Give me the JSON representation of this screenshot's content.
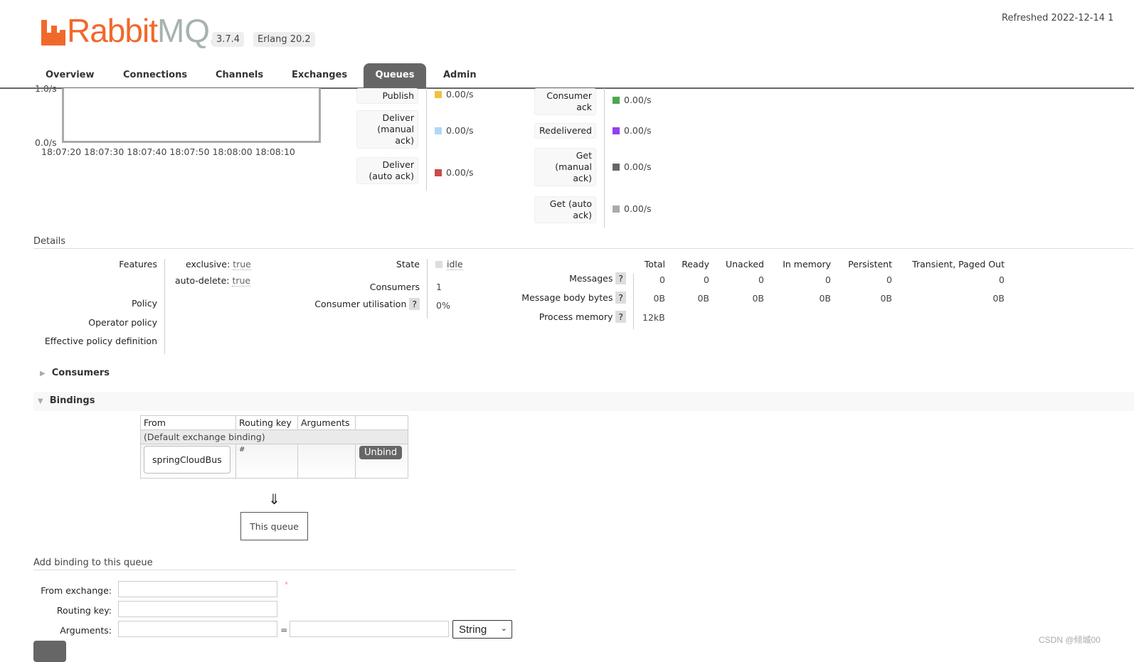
{
  "header": {
    "logo_text": "RabbitMQ",
    "version": "3.7.4",
    "erlang": "Erlang 20.2",
    "refreshed": "Refreshed 2022-12-14 1"
  },
  "nav": {
    "tabs": [
      "Overview",
      "Connections",
      "Channels",
      "Exchanges",
      "Queues",
      "Admin"
    ],
    "active": "Queues"
  },
  "chart": {
    "y_top": "1.0/s",
    "y_bottom": "0.0/s",
    "x_ticks": [
      "18:07:20",
      "18:07:30",
      "18:07:40",
      "18:07:50",
      "18:08:00",
      "18:08:10"
    ]
  },
  "rates_left": [
    {
      "label": "Publish",
      "value": "0.00/s",
      "color": "#edc240"
    },
    {
      "label": "Deliver (manual ack)",
      "value": "0.00/s",
      "color": "#afd8f8"
    },
    {
      "label": "Deliver (auto ack)",
      "value": "0.00/s",
      "color": "#cb4b4b"
    }
  ],
  "rates_right": [
    {
      "label": "Consumer ack",
      "value": "0.00/s",
      "color": "#4da74d"
    },
    {
      "label": "Redelivered",
      "value": "0.00/s",
      "color": "#9440ed"
    },
    {
      "label": "Get (manual ack)",
      "value": "0.00/s",
      "color": "#666666"
    },
    {
      "label": "Get (auto ack)",
      "value": "0.00/s",
      "color": "#aaaaaa"
    }
  ],
  "details": {
    "title": "Details",
    "features_label": "Features",
    "exclusive_k": "exclusive:",
    "exclusive_v": "true",
    "autodelete_k": "auto-delete:",
    "autodelete_v": "true",
    "policy": "Policy",
    "operator_policy": "Operator policy",
    "effective_policy": "Effective policy definition",
    "state_k": "State",
    "state_v": "idle",
    "consumers_k": "Consumers",
    "consumers_v": "1",
    "util_k": "Consumer utilisation",
    "util_v": "0%",
    "help": "?",
    "msg_cols": [
      "Total",
      "Ready",
      "Unacked",
      "In memory",
      "Persistent",
      "Transient, Paged Out"
    ],
    "messages_k": "Messages",
    "messages": [
      "0",
      "0",
      "0",
      "0",
      "0",
      "0"
    ],
    "bytes_k": "Message body bytes",
    "bytes": [
      "0B",
      "0B",
      "0B",
      "0B",
      "0B",
      "0B"
    ],
    "memory_k": "Process memory",
    "memory": "12kB"
  },
  "consumers_section": "Consumers",
  "bindings": {
    "title": "Bindings",
    "cols": [
      "From",
      "Routing key",
      "Arguments"
    ],
    "default_row": "(Default exchange binding)",
    "rows": [
      {
        "from": "springCloudBus",
        "routing_key": "#",
        "arguments": "",
        "action": "Unbind"
      }
    ],
    "arrow": "⇓",
    "this_queue": "This queue"
  },
  "add_binding": {
    "title": "Add binding to this queue",
    "from_label": "From exchange:",
    "required": "*",
    "routing_label": "Routing key:",
    "args_label": "Arguments:",
    "eq": "=",
    "type": "String"
  },
  "watermark": "CSDN @倾城00"
}
